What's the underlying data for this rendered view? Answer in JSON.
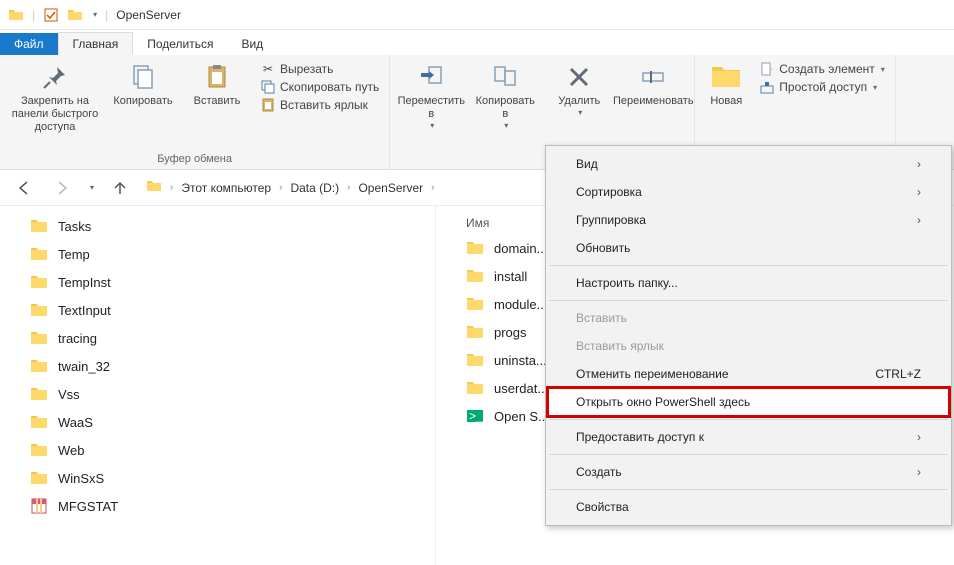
{
  "window": {
    "title": "OpenServer"
  },
  "tabs": {
    "file": "Файл",
    "home": "Главная",
    "share": "Поделиться",
    "view": "Вид"
  },
  "ribbon": {
    "pin": "Закрепить на панели быстрого доступа",
    "copy": "Копировать",
    "paste": "Вставить",
    "cut": "Вырезать",
    "copypath": "Скопировать путь",
    "paste_shortcut": "Вставить ярлык",
    "clipboard_group": "Буфер обмена",
    "moveto": "Переместить в",
    "copyto": "Копировать в",
    "delete": "Удалить",
    "rename": "Переименовать",
    "newfolder": "Новая",
    "newitem": "Создать элемент",
    "easyaccess": "Простой доступ"
  },
  "breadcrumb": {
    "root": "Этот компьютер",
    "drive": "Data (D:)",
    "folder": "OpenServer"
  },
  "left_items": [
    {
      "name": "Tasks",
      "type": "folder"
    },
    {
      "name": "Temp",
      "type": "folder"
    },
    {
      "name": "TempInst",
      "type": "folder"
    },
    {
      "name": "TextInput",
      "type": "folder"
    },
    {
      "name": "tracing",
      "type": "folder"
    },
    {
      "name": "twain_32",
      "type": "folder"
    },
    {
      "name": "Vss",
      "type": "folder"
    },
    {
      "name": "WaaS",
      "type": "folder"
    },
    {
      "name": "Web",
      "type": "folder"
    },
    {
      "name": "WinSxS",
      "type": "folder"
    },
    {
      "name": "MFGSTAT",
      "type": "archive"
    }
  ],
  "right_header": "Имя",
  "right_items": [
    {
      "name": "domain...",
      "type": "folder"
    },
    {
      "name": "install",
      "type": "folder"
    },
    {
      "name": "module...",
      "type": "folder"
    },
    {
      "name": "progs",
      "type": "folder"
    },
    {
      "name": "uninsta...",
      "type": "folder"
    },
    {
      "name": "userdat...",
      "type": "folder"
    },
    {
      "name": "Open S...",
      "type": "exe"
    }
  ],
  "context_menu": {
    "view": "Вид",
    "sort": "Сортировка",
    "group": "Группировка",
    "refresh": "Обновить",
    "customize": "Настроить папку...",
    "paste": "Вставить",
    "paste_shortcut": "Вставить ярлык",
    "undo_rename": "Отменить переименование",
    "undo_shortcut": "CTRL+Z",
    "powershell": "Открыть окно PowerShell здесь",
    "give_access": "Предоставить доступ к",
    "new": "Создать",
    "properties": "Свойства"
  }
}
